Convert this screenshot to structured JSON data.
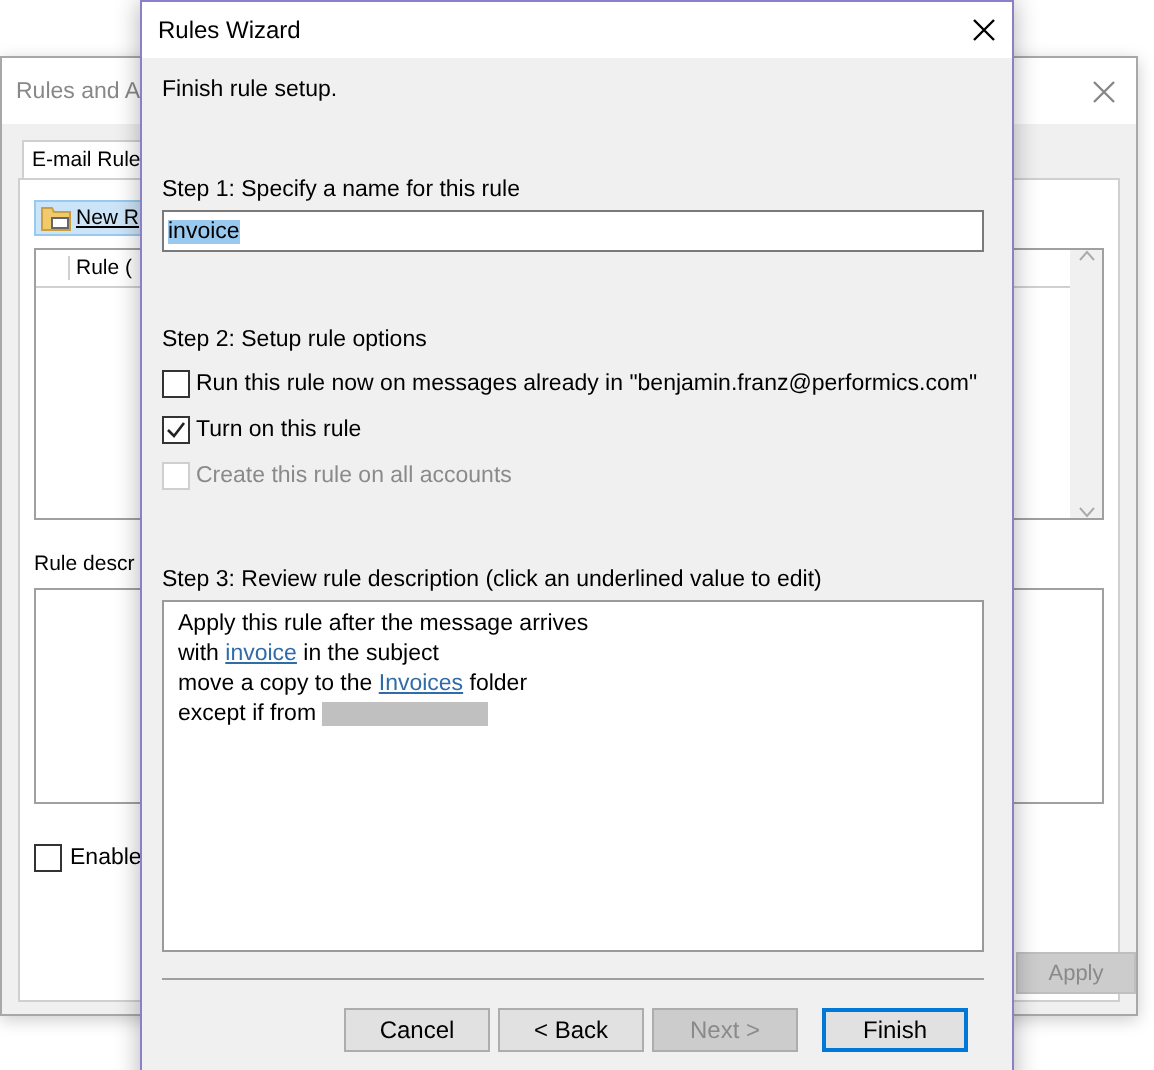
{
  "background_window": {
    "title": "Rules and A",
    "tab": {
      "label": "E-mail Rule",
      "selected": true
    },
    "new_rule_button": "New R",
    "list_column": "Rule (",
    "description_label": "Rule descr",
    "enable_checkbox": {
      "label": "Enable",
      "checked": false
    },
    "apply_button": {
      "label": "Apply",
      "disabled": true
    }
  },
  "dialog": {
    "title": "Rules Wizard",
    "heading": "Finish rule setup.",
    "step1": {
      "label": "Step 1: Specify a name for this rule",
      "value": "invoice"
    },
    "step2": {
      "label": "Step 2: Setup rule options",
      "options": [
        {
          "label": "Run this rule now on messages already in \"benjamin.franz@performics.com\"",
          "checked": false,
          "disabled": false
        },
        {
          "label": "Turn on this rule",
          "checked": true,
          "disabled": false
        },
        {
          "label": "Create this rule on all accounts",
          "checked": false,
          "disabled": true
        }
      ]
    },
    "step3": {
      "label": "Step 3: Review rule description (click an underlined value to edit)",
      "lines": [
        [
          {
            "kind": "plain",
            "text": "Apply this rule after the message arrives"
          }
        ],
        [
          {
            "kind": "plain",
            "text": "with "
          },
          {
            "kind": "link",
            "text": "invoice"
          },
          {
            "kind": "plain",
            "text": " in the subject"
          }
        ],
        [
          {
            "kind": "plain",
            "text": "move a copy to the "
          },
          {
            "kind": "link",
            "text": "Invoices"
          },
          {
            "kind": "plain",
            "text": " folder"
          }
        ],
        [
          {
            "kind": "plain",
            "text": "except if from "
          },
          {
            "kind": "redacted"
          }
        ]
      ]
    },
    "buttons": [
      {
        "label": "Cancel",
        "disabled": false,
        "default": false
      },
      {
        "label": "< Back",
        "disabled": false,
        "default": false
      },
      {
        "label": "Next >",
        "disabled": true,
        "default": false
      },
      {
        "label": "Finish",
        "disabled": false,
        "default": true
      }
    ]
  }
}
